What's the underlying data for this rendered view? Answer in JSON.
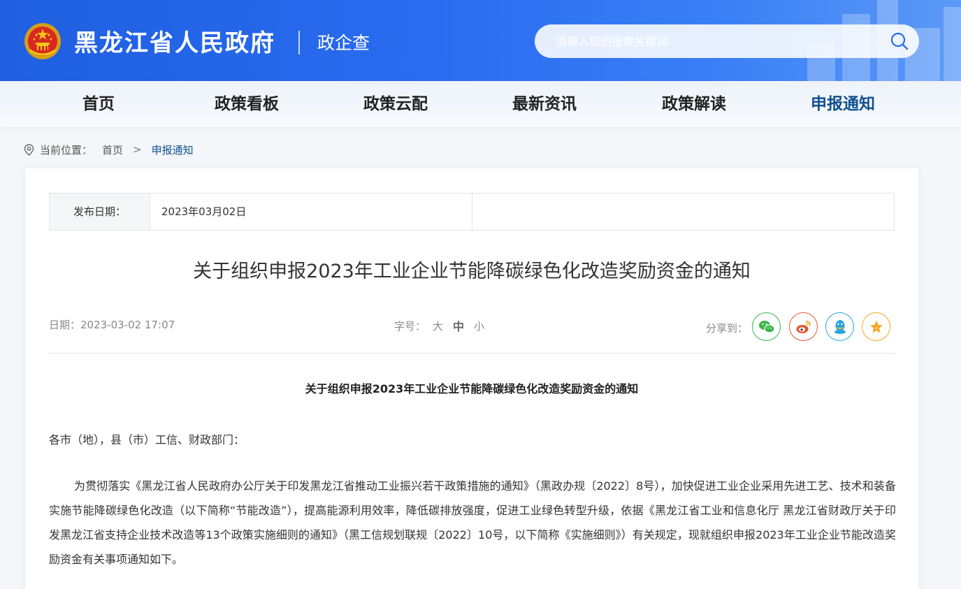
{
  "header": {
    "site_title": "黑龙江省人民政府",
    "sub_title": "政企查",
    "search_placeholder": "请输入您的搜索关键词",
    "icons": {
      "emblem": "national-emblem-icon",
      "search": "search-icon"
    },
    "colors": {
      "brand_blue": "#2a6cf0",
      "active_nav": "#11518f"
    }
  },
  "nav": {
    "items": [
      {
        "label": "首页"
      },
      {
        "label": "政策看板"
      },
      {
        "label": "政策云配"
      },
      {
        "label": "最新资讯"
      },
      {
        "label": "政策解读"
      },
      {
        "label": "申报通知",
        "active": true
      }
    ]
  },
  "breadcrumb": {
    "prefix": "当前位置：",
    "home": "首页",
    "separator": ">",
    "current": "申报通知"
  },
  "meta": {
    "publish_label": "发布日期：",
    "publish_date": "2023年03月02日"
  },
  "article": {
    "title": "关于组织申报2023年工业企业节能降碳绿色化改造奖励资金的通知",
    "date_text": "日期：2023-03-02 17:07",
    "font_size_label": "字号：",
    "font_sizes": [
      "大",
      "中",
      "小"
    ],
    "selected_font_size": "中",
    "share_label": "分享到：",
    "share_targets": [
      {
        "icon": "wechat-icon",
        "color": "#3bb54a"
      },
      {
        "icon": "weibo-icon",
        "color": "#e8542f"
      },
      {
        "icon": "qq-icon",
        "color": "#2aa3e0"
      },
      {
        "icon": "favorite-star-icon",
        "color": "#f5a623"
      }
    ],
    "doc_heading": "关于组织申报2023年工业企业节能降碳绿色化改造奖励资金的通知",
    "salutation": "各市（地），县（市）工信、财政部门：",
    "paragraph": "为贯彻落实《黑龙江省人民政府办公厅关于印发黑龙江省推动工业振兴若干政策措施的通知》（黑政办规〔2022〕8号），加快促进工业企业采用先进工艺、技术和装备实施节能降碳绿色化改造（以下简称“节能改造”），提高能源利用效率，降低碳排放强度，促进工业绿色转型升级，依据《黑龙江省工业和信息化厅 黑龙江省财政厅关于印发黑龙江省支持企业技术改造等13个政策实施细则的通知》（黑工信规划联规〔2022〕10号，以下简称《实施细则》）有关规定，现就组织申报2023年工业企业节能改造奖励资金有关事项通知如下。"
  }
}
